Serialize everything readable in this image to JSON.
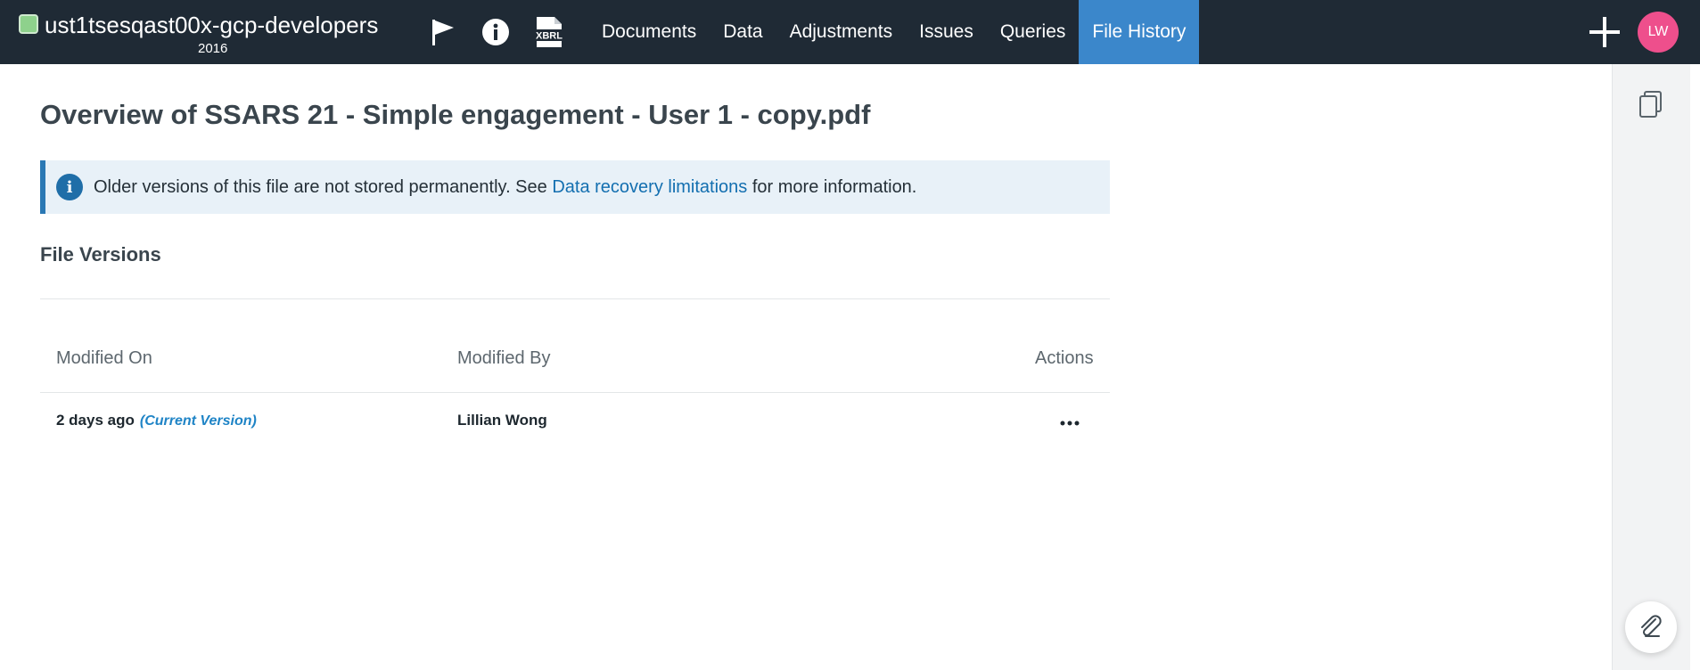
{
  "header": {
    "workspace_name": "ust1tsesqast00x-gcp-developers",
    "workspace_year": "2016",
    "icons": [
      "flag-icon",
      "info-icon",
      "xbrl-icon"
    ],
    "xbrl_label": "XBRL",
    "tabs": [
      {
        "label": "Documents"
      },
      {
        "label": "Data"
      },
      {
        "label": "Adjustments"
      },
      {
        "label": "Issues"
      },
      {
        "label": "Queries"
      },
      {
        "label": "File History",
        "active": true
      }
    ],
    "avatar_initials": "LW"
  },
  "colors": {
    "topbar": "#1f2a35",
    "active_tab": "#3b87cb",
    "avatar": "#ee4f8c",
    "link": "#136fb0",
    "status_dot": "#8ed18c"
  },
  "main": {
    "title": "Overview of SSARS 21 - Simple engagement - User 1 - copy.pdf",
    "banner": {
      "text_before": "Older versions of this file are not stored permanently. See ",
      "link_text": "Data recovery limitations",
      "text_after": " for more information."
    },
    "section_title": "File Versions",
    "table": {
      "columns": [
        "Modified On",
        "Modified By",
        "Actions"
      ],
      "rows": [
        {
          "modified_on": "2 days ago",
          "tag": "(Current Version)",
          "modified_by": "Lillian Wong"
        }
      ]
    }
  },
  "right_rail": {
    "icons": [
      "copy-icon",
      "paperclip-icon"
    ]
  }
}
